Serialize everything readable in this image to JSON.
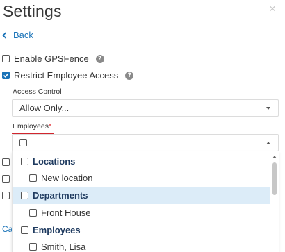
{
  "header": {
    "title": "Settings",
    "close_glyph": "×"
  },
  "nav": {
    "back_label": "Back"
  },
  "options": [
    {
      "label": "Enable GPSFence",
      "checked": false
    },
    {
      "label": "Restrict Employee Access",
      "checked": true
    }
  ],
  "access_control": {
    "label": "Access Control",
    "value": "Allow Only..."
  },
  "employees": {
    "label": "Employees",
    "required_mark": "*"
  },
  "background": {
    "cancel_fragment": "Ca"
  },
  "dropdown": {
    "items": [
      {
        "kind": "group",
        "label": "Locations",
        "checked": false
      },
      {
        "kind": "child",
        "label": "New location",
        "checked": false
      },
      {
        "kind": "group",
        "label": "Departments",
        "checked": false,
        "highlighted": true
      },
      {
        "kind": "child",
        "label": "Front House",
        "checked": false
      },
      {
        "kind": "group",
        "label": "Employees",
        "checked": false
      },
      {
        "kind": "child",
        "label": "Smith, Lisa",
        "checked": false
      }
    ]
  },
  "colors": {
    "accent": "#1a73b8",
    "required": "#e0262c",
    "highlight": "#dcecf8",
    "group_text": "#1e3a5f"
  }
}
